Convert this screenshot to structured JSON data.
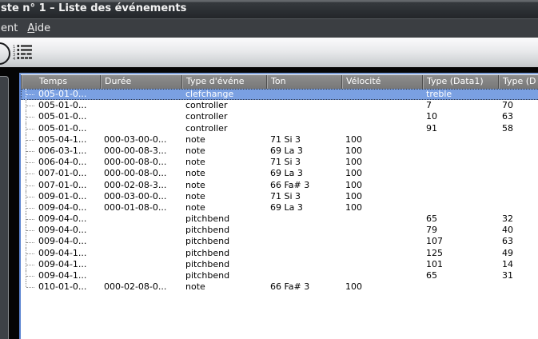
{
  "window": {
    "title": "ste n° 1 – Liste des événements"
  },
  "menu": {
    "items": [
      {
        "label": "ent"
      },
      {
        "label_accel": "A",
        "label_rest": "ide"
      }
    ]
  },
  "toolbar": {
    "icons": [
      "magnifier-partial-icon",
      "event-list-icon"
    ],
    "list_icon_digits": [
      "1",
      "2",
      "3",
      "4"
    ]
  },
  "table": {
    "columns": [
      "Temps",
      "Durée",
      "Type d'événe",
      "Ton",
      "Vélocité",
      "Type (Data1)",
      "Type (D"
    ],
    "rows": [
      {
        "temps": "005-01-0...",
        "duree": "",
        "type": "clefchange",
        "ton": "",
        "velocite": "",
        "data1": "treble",
        "data2": "",
        "selected": true
      },
      {
        "temps": "005-01-0...",
        "duree": "",
        "type": "controller",
        "ton": "",
        "velocite": "",
        "data1": "7",
        "data2": "70"
      },
      {
        "temps": "005-01-0...",
        "duree": "",
        "type": "controller",
        "ton": "",
        "velocite": "",
        "data1": "10",
        "data2": "63"
      },
      {
        "temps": "005-01-0...",
        "duree": "",
        "type": "controller",
        "ton": "",
        "velocite": "",
        "data1": "91",
        "data2": "58"
      },
      {
        "temps": "005-04-1...",
        "duree": "000-03-00-0...",
        "type": "note",
        "ton": "71 Si 3",
        "velocite": "100",
        "data1": "",
        "data2": ""
      },
      {
        "temps": "006-03-1...",
        "duree": "000-00-08-3...",
        "type": "note",
        "ton": "69 La 3",
        "velocite": "100",
        "data1": "",
        "data2": ""
      },
      {
        "temps": "006-04-0...",
        "duree": "000-00-08-0...",
        "type": "note",
        "ton": "71 Si 3",
        "velocite": "100",
        "data1": "",
        "data2": ""
      },
      {
        "temps": "007-01-0...",
        "duree": "000-00-08-0...",
        "type": "note",
        "ton": "69 La 3",
        "velocite": "100",
        "data1": "",
        "data2": ""
      },
      {
        "temps": "007-01-0...",
        "duree": "000-02-08-3...",
        "type": "note",
        "ton": "66 Fa# 3",
        "velocite": "100",
        "data1": "",
        "data2": ""
      },
      {
        "temps": "009-01-0...",
        "duree": "000-03-00-0...",
        "type": "note",
        "ton": "71 Si 3",
        "velocite": "100",
        "data1": "",
        "data2": ""
      },
      {
        "temps": "009-04-0...",
        "duree": "000-01-08-0...",
        "type": "note",
        "ton": "69 La 3",
        "velocite": "100",
        "data1": "",
        "data2": ""
      },
      {
        "temps": "009-04-0...",
        "duree": "",
        "type": "pitchbend",
        "ton": "",
        "velocite": "",
        "data1": "65",
        "data2": "32"
      },
      {
        "temps": "009-04-0...",
        "duree": "",
        "type": "pitchbend",
        "ton": "",
        "velocite": "",
        "data1": "79",
        "data2": "40"
      },
      {
        "temps": "009-04-0...",
        "duree": "",
        "type": "pitchbend",
        "ton": "",
        "velocite": "",
        "data1": "107",
        "data2": "63"
      },
      {
        "temps": "009-04-1...",
        "duree": "",
        "type": "pitchbend",
        "ton": "",
        "velocite": "",
        "data1": "125",
        "data2": "49"
      },
      {
        "temps": "009-04-1...",
        "duree": "",
        "type": "pitchbend",
        "ton": "",
        "velocite": "",
        "data1": "101",
        "data2": "14"
      },
      {
        "temps": "009-04-1...",
        "duree": "",
        "type": "pitchbend",
        "ton": "",
        "velocite": "",
        "data1": "65",
        "data2": "31"
      },
      {
        "temps": "010-01-0...",
        "duree": "000-02-08-0...",
        "type": "note",
        "ton": "66 Fa# 3",
        "velocite": "100",
        "data1": "",
        "data2": ""
      }
    ]
  },
  "colors": {
    "selection_blue": "#7aa0e2",
    "frame_focus_blue": "#5b84d2",
    "header_gray": "#7f7f7f",
    "titlebar_dark": "#2b2f33",
    "menubar_dark": "#3b3e42"
  }
}
